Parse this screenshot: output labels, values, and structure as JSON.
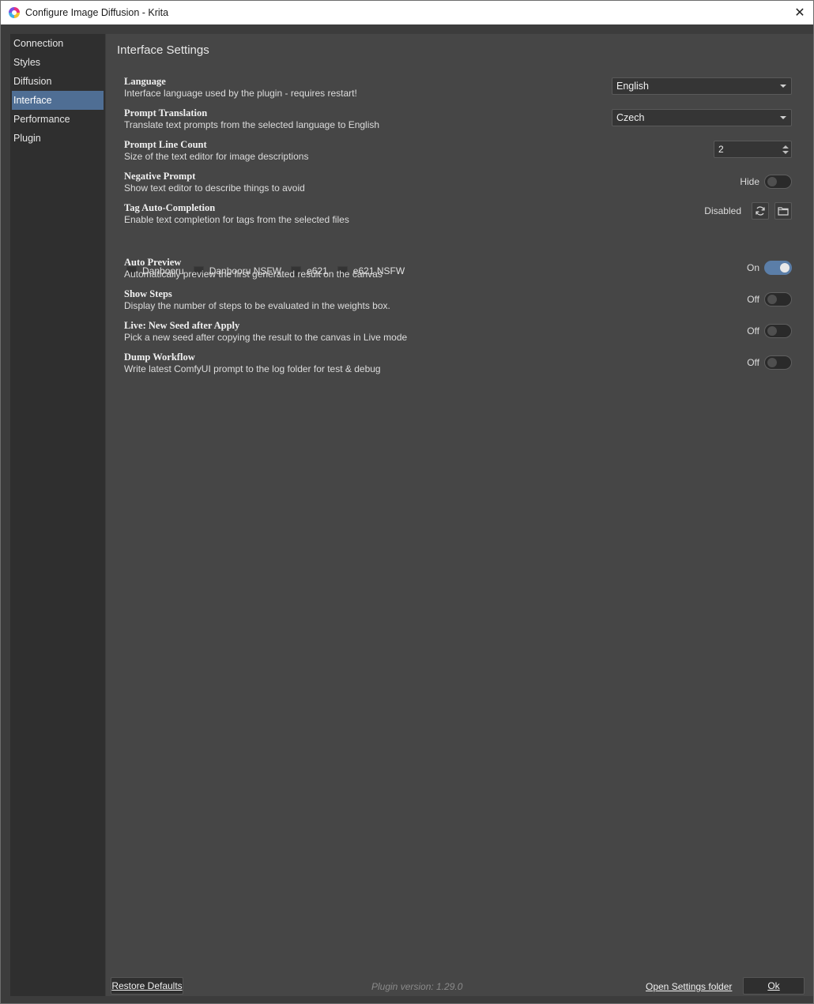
{
  "window": {
    "title": "Configure Image Diffusion - Krita",
    "close_symbol": "✕"
  },
  "sidebar": {
    "items": [
      {
        "label": "Connection"
      },
      {
        "label": "Styles"
      },
      {
        "label": "Diffusion"
      },
      {
        "label": "Interface",
        "active": true
      },
      {
        "label": "Performance"
      },
      {
        "label": "Plugin"
      }
    ]
  },
  "page": {
    "title": "Interface Settings"
  },
  "settings": {
    "language": {
      "title": "Language",
      "desc": "Interface language used by the plugin - requires restart!",
      "value": "English"
    },
    "prompt_translation": {
      "title": "Prompt Translation",
      "desc": "Translate text prompts from the selected language to English",
      "value": "Czech"
    },
    "prompt_line_count": {
      "title": "Prompt Line Count",
      "desc": "Size of the text editor for image descriptions",
      "value": "2"
    },
    "negative_prompt": {
      "title": "Negative Prompt",
      "desc": "Show text editor to describe things to avoid",
      "state": "Hide",
      "on": false
    },
    "tag_auto_completion": {
      "title": "Tag Auto-Completion",
      "desc": "Enable text completion for tags from the selected files",
      "status": "Disabled",
      "files": [
        "Danbooru",
        "Danbooru NSFW",
        "e621",
        "e621 NSFW"
      ]
    },
    "auto_preview": {
      "title": "Auto Preview",
      "desc": "Automatically preview the first generated result on the canvas",
      "state": "On",
      "on": true
    },
    "show_steps": {
      "title": "Show Steps",
      "desc": "Display the number of steps to be evaluated in the weights box.",
      "state": "Off",
      "on": false
    },
    "live_new_seed": {
      "title": "Live: New Seed after Apply",
      "desc": "Pick a new seed after copying the result to the canvas in Live mode",
      "state": "Off",
      "on": false
    },
    "dump_workflow": {
      "title": "Dump Workflow",
      "desc": "Write latest ComfyUI prompt to the log folder for test & debug",
      "state": "Off",
      "on": false
    }
  },
  "footer": {
    "restore_label": "Restore Defaults",
    "version": "Plugin version: 1.29.0",
    "settings_folder_label": "Open Settings folder",
    "ok_label": "Ok"
  },
  "colors": {
    "accent": "#4f6e94",
    "toggle_on": "#5b7ea8",
    "panel": "#464646",
    "sidebar": "#2f2f2f"
  }
}
